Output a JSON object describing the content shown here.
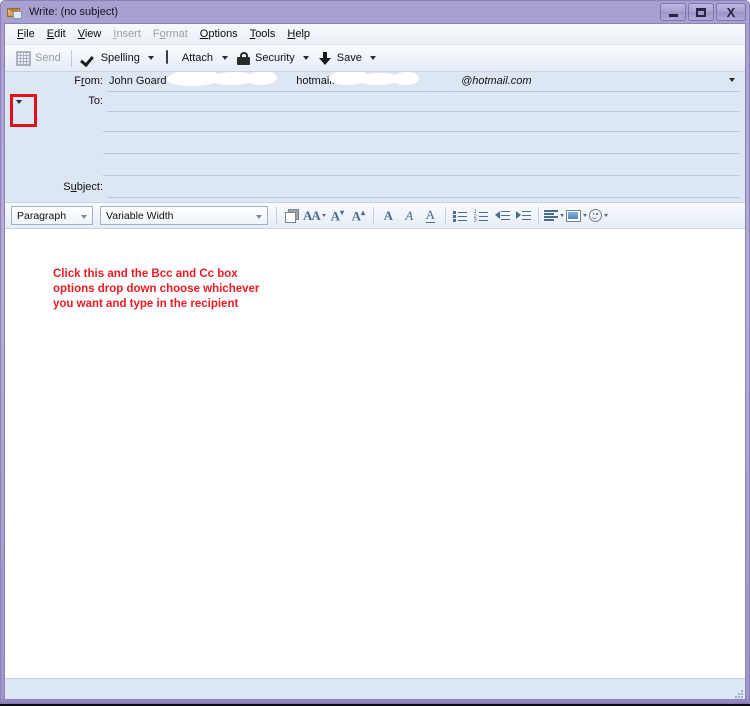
{
  "window": {
    "title": "Write: (no subject)",
    "icon": "compose-mail-icon",
    "buttons": {
      "minimize": "–",
      "maximize": "□",
      "close": "X"
    }
  },
  "menubar": {
    "items": [
      {
        "label": "File",
        "disabled": false
      },
      {
        "label": "Edit",
        "disabled": false
      },
      {
        "label": "View",
        "disabled": false
      },
      {
        "label": "Insert",
        "disabled": true
      },
      {
        "label": "Format",
        "disabled": true
      },
      {
        "label": "Options",
        "disabled": false
      },
      {
        "label": "Tools",
        "disabled": false
      },
      {
        "label": "Help",
        "disabled": false
      }
    ]
  },
  "toolbar": {
    "send_label": "Send",
    "spelling_label": "Spelling",
    "attach_label": "Attach",
    "security_label": "Security",
    "save_label": "Save"
  },
  "headers": {
    "from_label": "From:",
    "from_value": "John Goard ·",
    "from_value_mid": "hotmail.com>",
    "from_value_end": "@hotmail.com",
    "to_label": "To:",
    "to_value": "",
    "recipient_rows": [
      "",
      "",
      ""
    ],
    "subject_label": "Subject:",
    "subject_value": "",
    "expander_icon": "chevron-down-icon"
  },
  "format_toolbar": {
    "paragraph_style": "Paragraph",
    "font_family": "Variable Width",
    "buttons": [
      "text-color-swatch",
      "font-size-picker",
      "decrease-font-size",
      "increase-font-size",
      "bold",
      "italic",
      "underline",
      "bulleted-list",
      "numbered-list",
      "decrease-indent",
      "increase-indent",
      "align",
      "insert-image",
      "insert-smiley"
    ]
  },
  "body": {
    "annotation_lines": [
      "Click this and the Bcc and Cc box",
      "options drop down choose whichever",
      "you want and type in the recipient"
    ],
    "annotation_color": "#ee1b24",
    "content": ""
  },
  "highlight": {
    "color": "#e1111a",
    "target": "recipient-type-expander"
  }
}
